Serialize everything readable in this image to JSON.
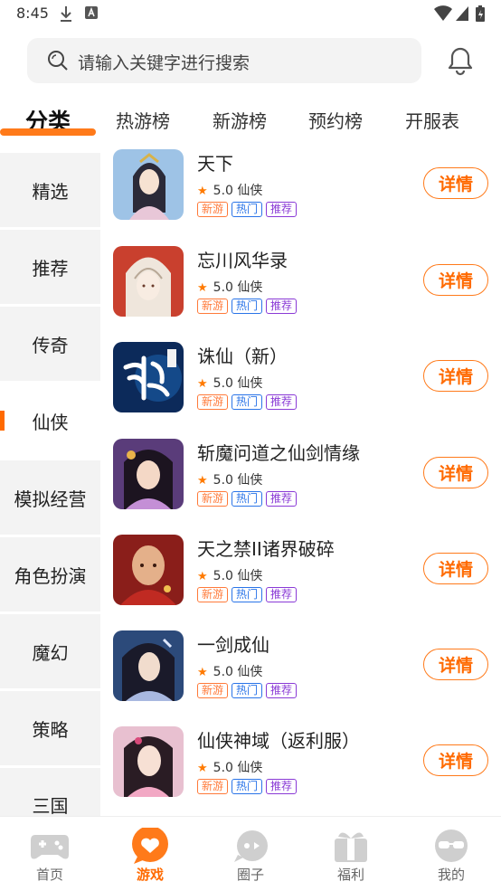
{
  "status_bar": {
    "time": "8:45"
  },
  "search": {
    "placeholder": "请输入关键字进行搜索"
  },
  "tabs": [
    {
      "label": "分类",
      "active": true
    },
    {
      "label": "热游榜"
    },
    {
      "label": "新游榜"
    },
    {
      "label": "预约榜"
    },
    {
      "label": "开服表"
    }
  ],
  "sidebar": {
    "items": [
      {
        "label": "精选"
      },
      {
        "label": "推荐"
      },
      {
        "label": "传奇"
      },
      {
        "label": "仙侠",
        "active": true
      },
      {
        "label": "模拟经营"
      },
      {
        "label": "角色扮演"
      },
      {
        "label": "魔幻"
      },
      {
        "label": "策略"
      },
      {
        "label": "三国"
      }
    ]
  },
  "games": [
    {
      "name": "天下",
      "rating": "5.0",
      "category": "仙侠",
      "tags": [
        "新游",
        "热门",
        "推荐"
      ],
      "action": "详情"
    },
    {
      "name": "忘川风华录",
      "rating": "5.0",
      "category": "仙侠",
      "tags": [
        "新游",
        "热门",
        "推荐"
      ],
      "action": "详情"
    },
    {
      "name": "诛仙（新）",
      "rating": "5.0",
      "category": "仙侠",
      "tags": [
        "新游",
        "热门",
        "推荐"
      ],
      "action": "详情"
    },
    {
      "name": "斩魔问道之仙剑情缘",
      "rating": "5.0",
      "category": "仙侠",
      "tags": [
        "新游",
        "热门",
        "推荐"
      ],
      "action": "详情"
    },
    {
      "name": "天之禁II诸界破碎",
      "rating": "5.0",
      "category": "仙侠",
      "tags": [
        "新游",
        "热门",
        "推荐"
      ],
      "action": "详情"
    },
    {
      "name": "一剑成仙",
      "rating": "5.0",
      "category": "仙侠",
      "tags": [
        "新游",
        "热门",
        "推荐"
      ],
      "action": "详情"
    },
    {
      "name": "仙侠神域（返利服）",
      "rating": "5.0",
      "category": "仙侠",
      "tags": [
        "新游",
        "热门",
        "推荐"
      ],
      "action": "详情"
    }
  ],
  "bottom_nav": [
    {
      "label": "首页",
      "icon": "gamepad-icon"
    },
    {
      "label": "游戏",
      "icon": "heart-chat-icon",
      "active": true
    },
    {
      "label": "圈子",
      "icon": "chat-bubble-icon"
    },
    {
      "label": "福利",
      "icon": "gift-icon"
    },
    {
      "label": "我的",
      "icon": "sunglasses-face-icon"
    }
  ],
  "colors": {
    "accent": "#ff6a00",
    "tag_new": "#ff7a3a",
    "tag_hot": "#2a74e8",
    "tag_rec": "#8a3ad6"
  }
}
